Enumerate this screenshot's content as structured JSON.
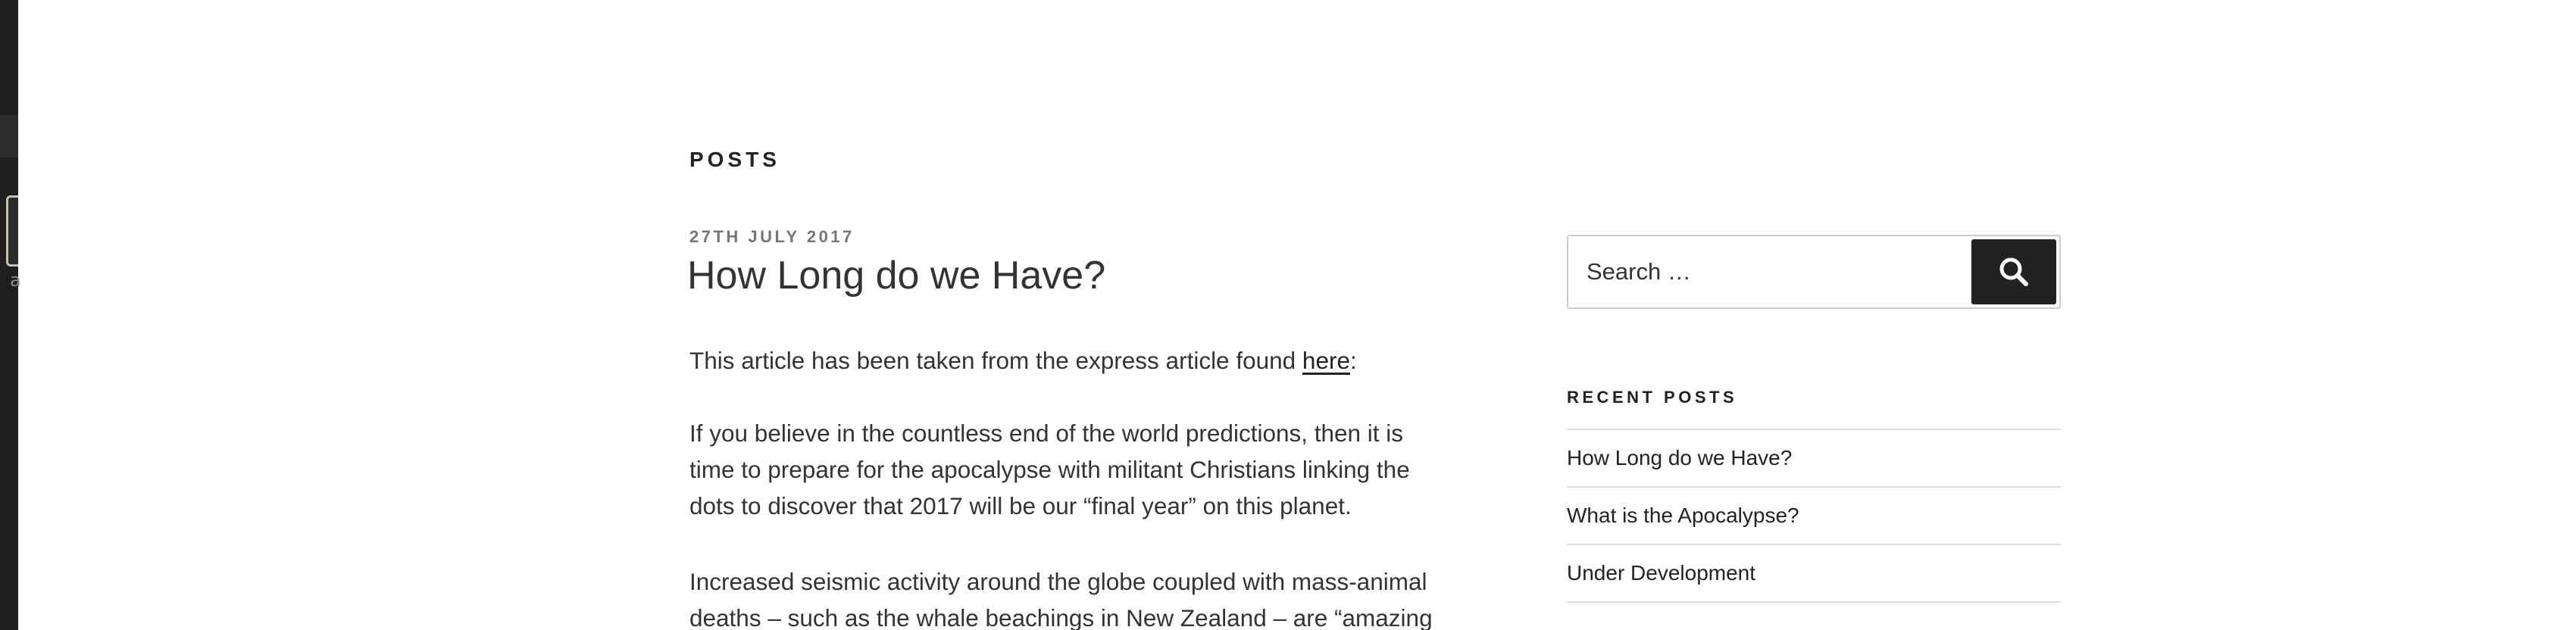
{
  "page_header": "POSTS",
  "post": {
    "date": "27TH JULY 2017",
    "title": "How Long do we Have?",
    "para1_before": "This article has been taken from the express article found ",
    "para1_link": "here",
    "para1_after": ":",
    "para2_lines": [
      "If you believe in the countless end of the world predictions, then it is",
      "time to prepare for the apocalypse with militant Christians linking the",
      "dots to discover that 2017 will be our “final year” on this planet."
    ],
    "para3_lines": [
      "Increased seismic activity around the globe coupled with mass-animal",
      "deaths – such as the whale beachings in New Zealand – are “amazing"
    ]
  },
  "sidebar": {
    "search": {
      "placeholder": "Search …",
      "button_icon": "search-icon"
    },
    "recent_posts": {
      "heading": "RECENT POSTS",
      "items": [
        "How Long do we Have?",
        "What is the Apocalypse?",
        "Under Development"
      ]
    }
  },
  "left_strip": {
    "glyph": "a"
  }
}
